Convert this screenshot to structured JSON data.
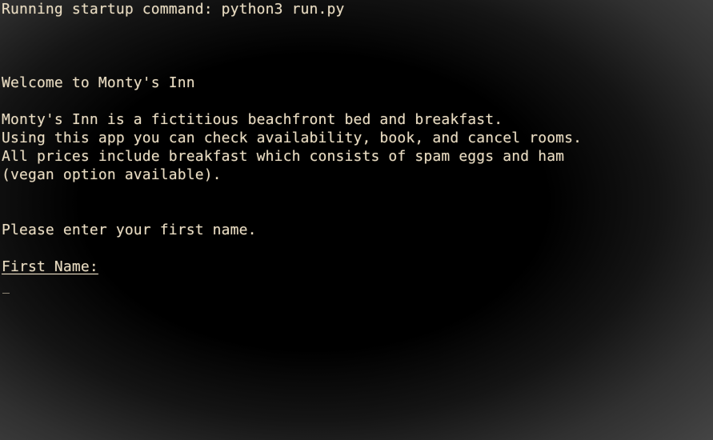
{
  "terminal": {
    "startup_line": "Running startup command: python3 run.py",
    "welcome_line": "Welcome to Monty's Inn",
    "intro_lines": [
      "Monty's Inn is a fictitious beachfront bed and breakfast.",
      "Using this app you can check availability, book, and cancel rooms.",
      "All prices include breakfast which consists of spam eggs and ham",
      "(vegan option available)."
    ],
    "prompt_line": "Please enter your first name.",
    "input_label": "First Name:"
  },
  "colors": {
    "background": "#000000",
    "text": "#e9dcc2"
  }
}
